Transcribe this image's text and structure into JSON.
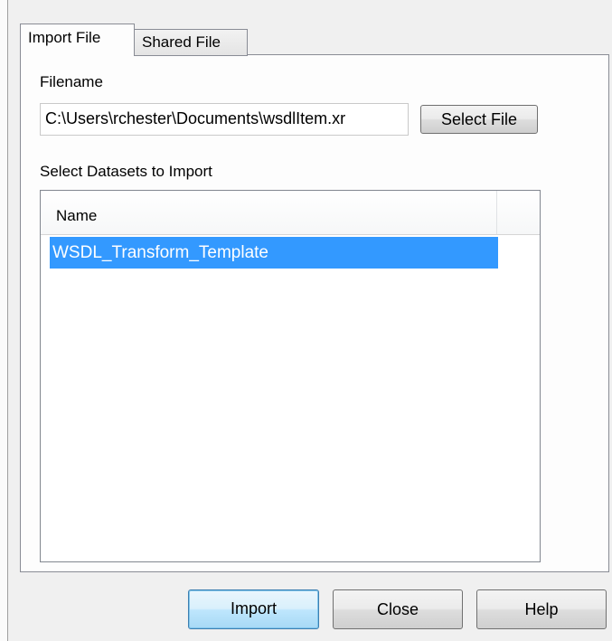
{
  "tabs": [
    {
      "label": "Import File",
      "active": true
    },
    {
      "label": "Shared File",
      "active": false
    }
  ],
  "filename": {
    "label": "Filename",
    "value": "C:\\Users\\rchester\\Documents\\wsdlItem.xr"
  },
  "select_file_button": "Select File",
  "datasets": {
    "label": "Select Datasets to Import",
    "column_header": "Name",
    "rows": [
      {
        "name": "WSDL_Transform_Template",
        "selected": true
      }
    ]
  },
  "buttons": {
    "import": "Import",
    "close": "Close",
    "help": "Help"
  },
  "colors": {
    "selection": "#3399ff",
    "default_button_border": "#3c7fb1"
  }
}
